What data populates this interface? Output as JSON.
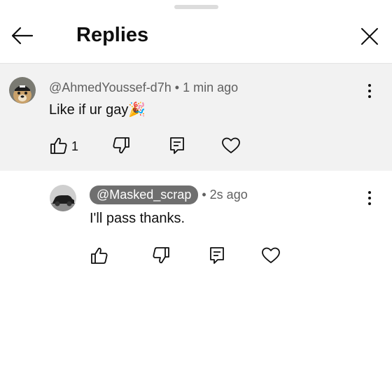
{
  "header": {
    "title": "Replies"
  },
  "parent_comment": {
    "author": "@AhmedYoussef-d7h",
    "time": "1 min ago",
    "text": "Like if ur gay",
    "like_count": "1"
  },
  "reply": {
    "author": "@Masked_scrap",
    "time": "2s ago",
    "text": "I'll pass thanks."
  },
  "separator": "•",
  "emoji": "🎉"
}
